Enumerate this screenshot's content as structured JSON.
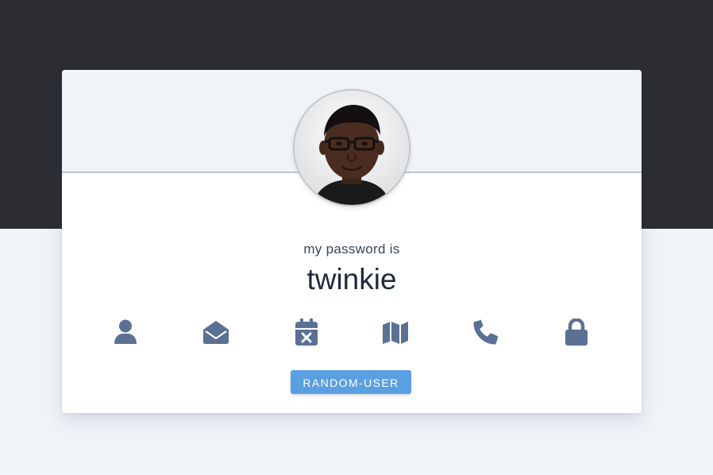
{
  "profile": {
    "caption": "my password is",
    "value": "twinkie"
  },
  "icons": [
    {
      "name": "user-icon"
    },
    {
      "name": "envelope-open-icon"
    },
    {
      "name": "calendar-x-icon"
    },
    {
      "name": "map-icon"
    },
    {
      "name": "phone-icon"
    },
    {
      "name": "lock-icon"
    }
  ],
  "button": {
    "label": "RANDOM-USER"
  },
  "colors": {
    "top_band": "#2c2e33",
    "page_background": "#f0f4f8",
    "icon": "#5a7194",
    "button": "#5b9fe3"
  }
}
